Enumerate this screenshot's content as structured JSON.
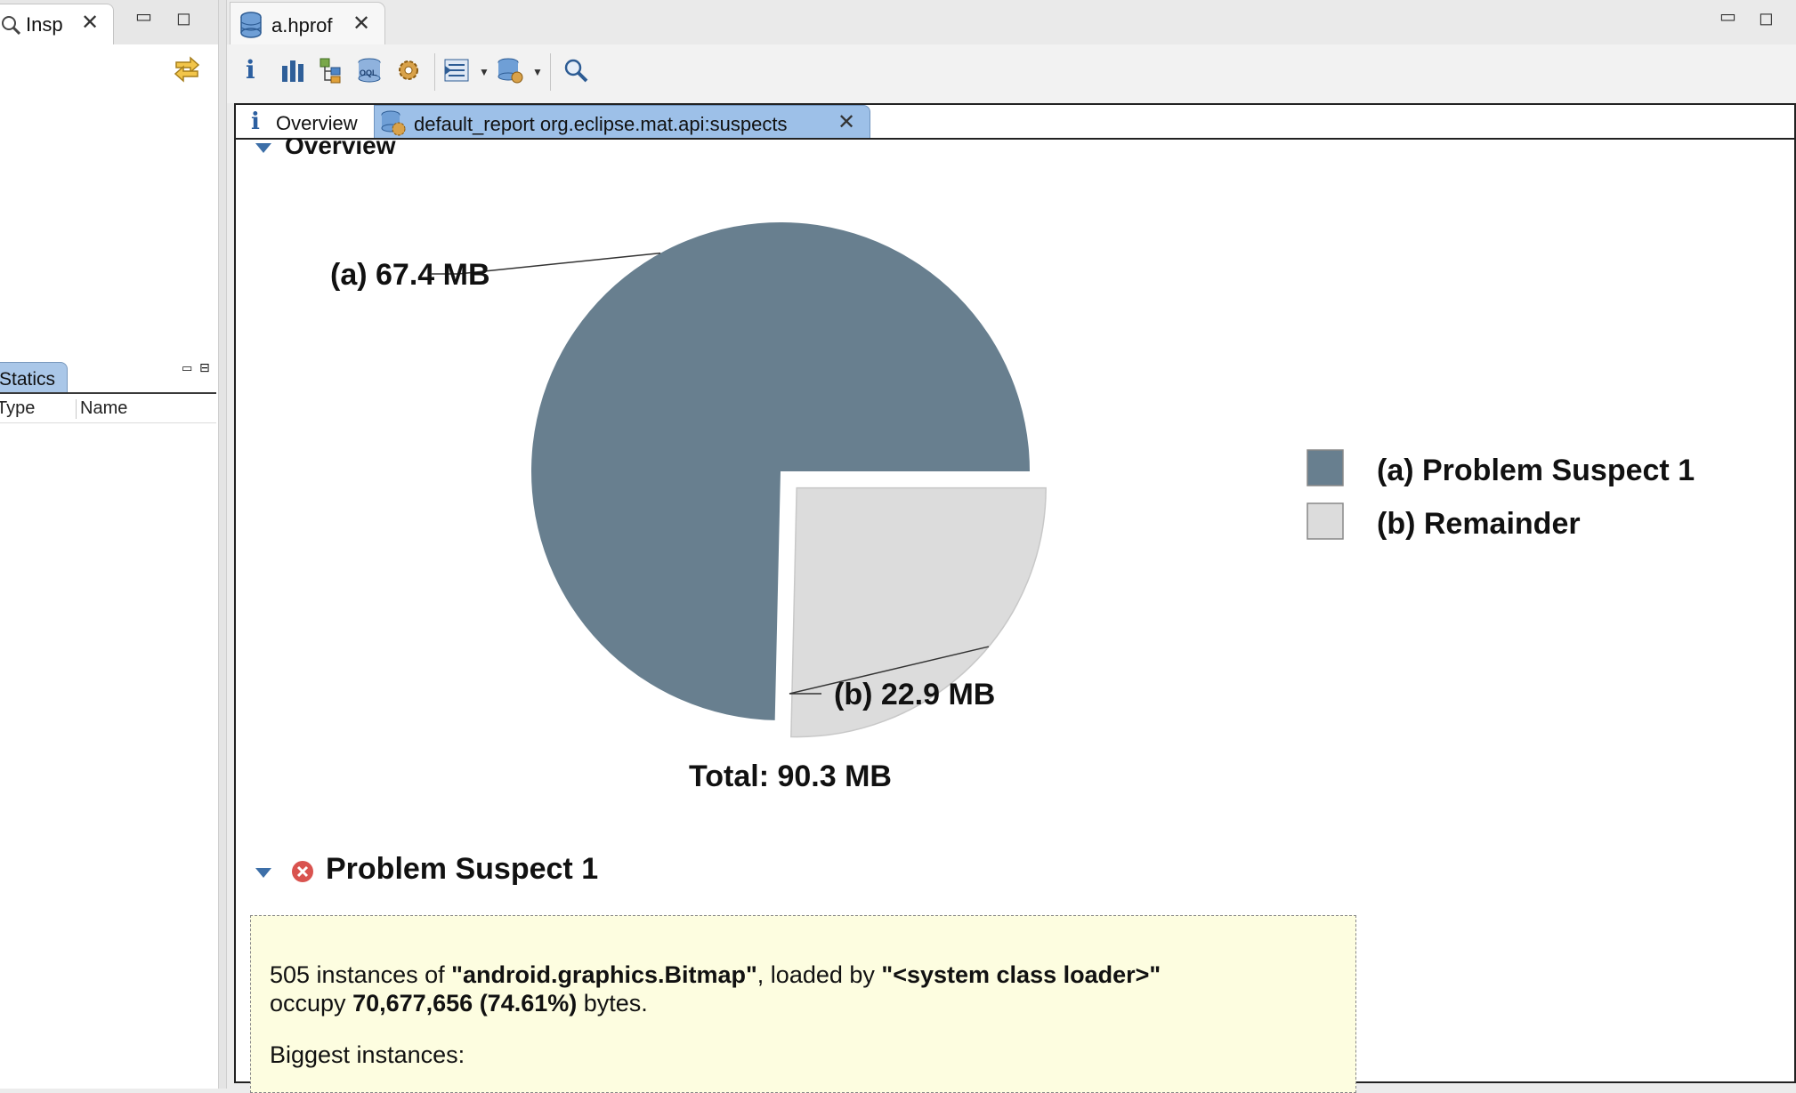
{
  "left_panel": {
    "inspector_tab_label": "Insp",
    "statics_tab_label": "Statics",
    "columns": [
      "Type",
      "Name"
    ]
  },
  "editor": {
    "file_tab_label": "a.hprof",
    "toolbar_icons": [
      "info-icon",
      "histogram-icon",
      "dominator-tree-icon",
      "oql-icon",
      "thread-overview-icon",
      "query-browser-icon",
      "heap-dump-actions-icon",
      "search-icon"
    ],
    "report_tabs": {
      "overview_label": "Overview",
      "report_label": "default_report  org.eclipse.mat.api:suspects"
    }
  },
  "report": {
    "overview_heading": "Overview",
    "problem_heading": "Problem Suspect 1",
    "suspect_text": {
      "line1_prefix": "505 instances of ",
      "class_name": "\"android.graphics.Bitmap\"",
      "line1_mid": ", loaded by ",
      "loader": "\"<system class loader>\"",
      "line2_prefix": "occupy ",
      "bytes": "70,677,656 (74.61%)",
      "line2_suffix": " bytes.",
      "biggest": "Biggest instances:"
    }
  },
  "chart_data": {
    "type": "pie",
    "title": "",
    "total_label": "Total: 90.3 MB",
    "slices": [
      {
        "key": "(a)",
        "name": "Problem Suspect 1",
        "value": 67.4,
        "label": "67.4 MB",
        "color": "#687f8f"
      },
      {
        "key": "(b)",
        "name": "Remainder",
        "value": 22.9,
        "label": "22.9 MB",
        "color": "#dcdcdc"
      }
    ],
    "legend_placement": "right"
  },
  "colors": {
    "selected_tab": "#9dc0e8",
    "suspect_box_bg": "#fdfde0",
    "twisty": "#3d6fa8",
    "error_icon": "#d9534f"
  }
}
